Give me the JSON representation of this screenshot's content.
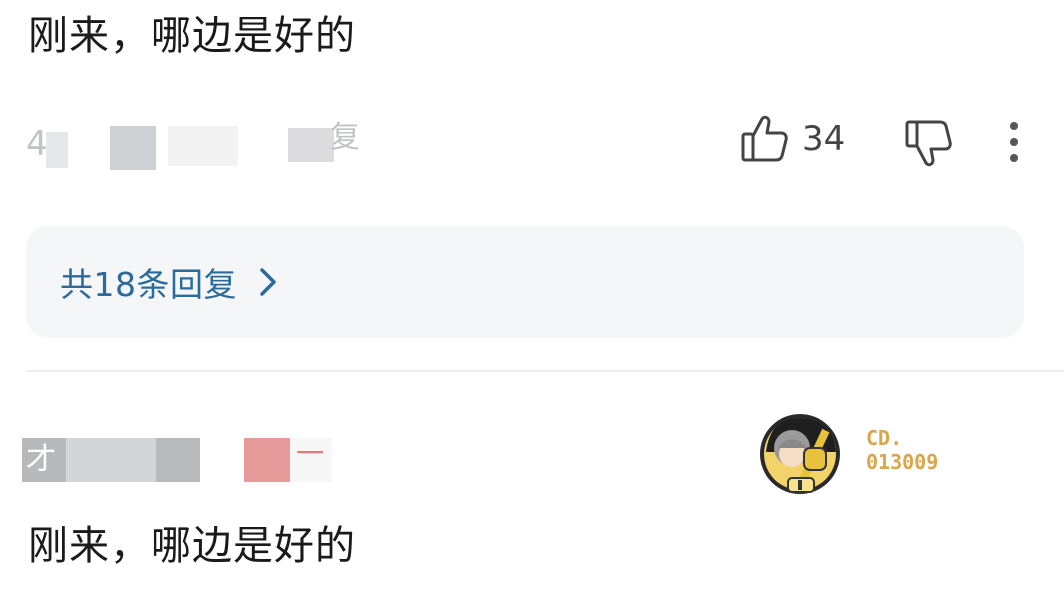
{
  "comment1": {
    "text": "刚来，哪边是好的",
    "meta_fragment_left": "4",
    "meta_fragment_right": "复",
    "like_count": "34"
  },
  "replies": {
    "label": "共18条回复"
  },
  "comment2": {
    "text": "刚来，哪边是好的",
    "meta_fragment_left": "才",
    "meta_fragment_right": "一",
    "badge": {
      "line1": "CD.",
      "line2": "013009"
    }
  },
  "colors": {
    "reply_link": "#2b6a9b",
    "replies_bg": "#f4f6f8",
    "badge_gold": "#d9a64a"
  },
  "icons": [
    "thumbs-up-icon",
    "thumbs-down-icon",
    "more-vertical-icon",
    "chevron-right-icon",
    "fan-badge-avatar-icon"
  ]
}
